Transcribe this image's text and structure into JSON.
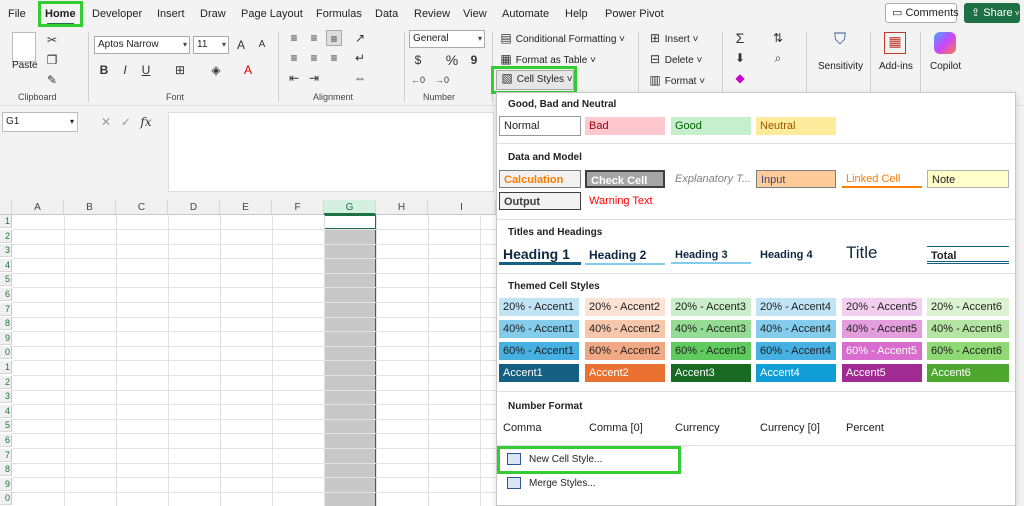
{
  "menu": {
    "tabs": [
      "File",
      "Home",
      "Developer",
      "Insert",
      "Draw",
      "Page Layout",
      "Formulas",
      "Data",
      "Review",
      "View",
      "Automate",
      "Help",
      "Power Pivot"
    ],
    "active_tab": "Home",
    "comments_label": "Comments",
    "share_label": "Share"
  },
  "ribbon": {
    "clipboard": {
      "paste_label": "Paste",
      "group_label": "Clipboard"
    },
    "font": {
      "font_name": "Aptos Narrow",
      "font_size": "11",
      "bold": "B",
      "italic": "I",
      "underline": "U",
      "group_label": "Font"
    },
    "alignment": {
      "group_label": "Alignment"
    },
    "number": {
      "format": "General",
      "currency": "$",
      "percent": "%",
      "comma": "9",
      "group_label": "Number"
    },
    "styles": {
      "conditional_formatting": "Conditional Formatting",
      "format_as_table": "Format as Table",
      "cell_styles": "Cell Styles"
    },
    "cells": {
      "insert": "Insert",
      "delete": "Delete",
      "format": "Format"
    },
    "sensitivity": "Sensitivity",
    "add_ins": "Add-ins",
    "copilot": "Copilot"
  },
  "formula_bar": {
    "name_box": "G1",
    "fx": "fx",
    "value": ""
  },
  "grid": {
    "columns": [
      "A",
      "B",
      "C",
      "D",
      "E",
      "F",
      "G",
      "H",
      "I"
    ],
    "selected_column": "G",
    "rows": [
      "1",
      "2",
      "3",
      "4",
      "5",
      "6",
      "7",
      "8",
      "9",
      "0",
      "1",
      "2",
      "3",
      "4",
      "5",
      "6",
      "7",
      "8",
      "9",
      "0"
    ]
  },
  "cell_styles": {
    "sections": {
      "good_bad": "Good, Bad and Neutral",
      "data_model": "Data and Model",
      "titles": "Titles and Headings",
      "themed": "Themed Cell Styles",
      "number_format": "Number Format"
    },
    "good_bad": [
      "Normal",
      "Bad",
      "Good",
      "Neutral"
    ],
    "data_model_row1": [
      "Calculation",
      "Check Cell",
      "Explanatory T...",
      "Input",
      "Linked Cell",
      "Note"
    ],
    "data_model_row2": [
      "Output",
      "Warning Text"
    ],
    "titles": [
      "Heading 1",
      "Heading 2",
      "Heading 3",
      "Heading 4",
      "Title",
      "Total"
    ],
    "themed_20": [
      "20% - Accent1",
      "20% - Accent2",
      "20% - Accent3",
      "20% - Accent4",
      "20% - Accent5",
      "20% - Accent6"
    ],
    "themed_40": [
      "40% - Accent1",
      "40% - Accent2",
      "40% - Accent3",
      "40% - Accent4",
      "40% - Accent5",
      "40% - Accent6"
    ],
    "themed_60": [
      "60% - Accent1",
      "60% - Accent2",
      "60% - Accent3",
      "60% - Accent4",
      "60% - Accent5",
      "60% - Accent6"
    ],
    "accents": [
      "Accent1",
      "Accent2",
      "Accent3",
      "Accent4",
      "Accent5",
      "Accent6"
    ],
    "number_format": [
      "Comma",
      "Comma [0]",
      "Currency",
      "Currency [0]",
      "Percent"
    ],
    "new_cell_style": "New Cell Style...",
    "merge_styles": "Merge Styles..."
  },
  "colors": {
    "excel_green": "#1e7145",
    "highlight": "#33cc33",
    "c20": [
      "#c0e4f5",
      "#fbe2d5",
      "#caedca",
      "#c0e4f5",
      "#f2ceef",
      "#dbf2d0"
    ],
    "c40": [
      "#83cceb",
      "#f7c7ac",
      "#94dc94",
      "#83cceb",
      "#e59edd",
      "#b4e5a2"
    ],
    "c60": [
      "#45b0e1",
      "#f1a983",
      "#5fcb5f",
      "#45b0e1",
      "#d86dcd",
      "#8ed973"
    ],
    "c100": [
      "#156082",
      "#e97132",
      "#196b24",
      "#0f9ed5",
      "#a02b93",
      "#4ea72e"
    ]
  }
}
